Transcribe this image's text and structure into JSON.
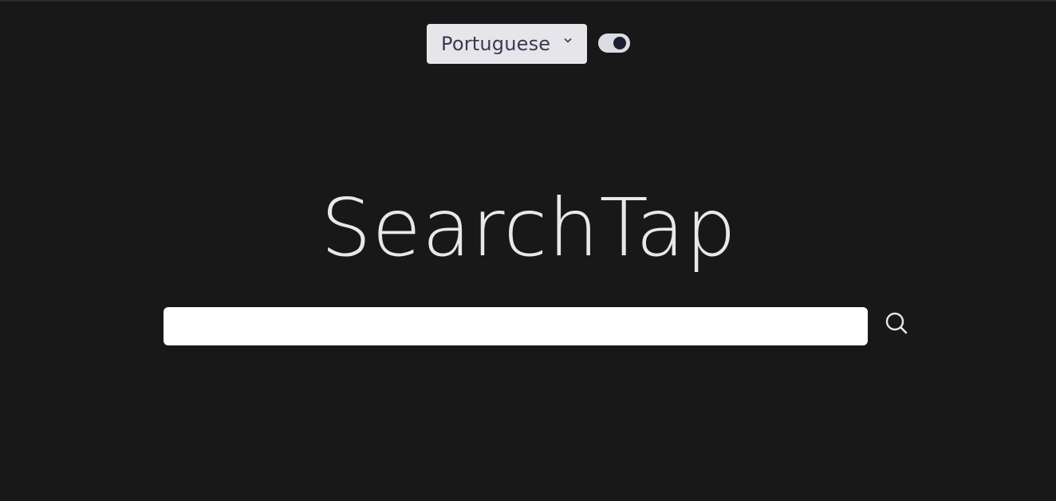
{
  "header": {
    "language_select": {
      "selected": "Portuguese"
    },
    "theme_toggle": {
      "state": "on",
      "track_color": "#dcdce2",
      "knob_color": "#1c1f33"
    }
  },
  "main": {
    "logo_text": "SearchTap",
    "search": {
      "value": "",
      "placeholder": "",
      "button_icon": "search-icon"
    }
  },
  "colors": {
    "background": "#181818",
    "logo": "#e8e8ec",
    "select_bg": "#e6e6ea",
    "select_text": "#3a3a52"
  }
}
